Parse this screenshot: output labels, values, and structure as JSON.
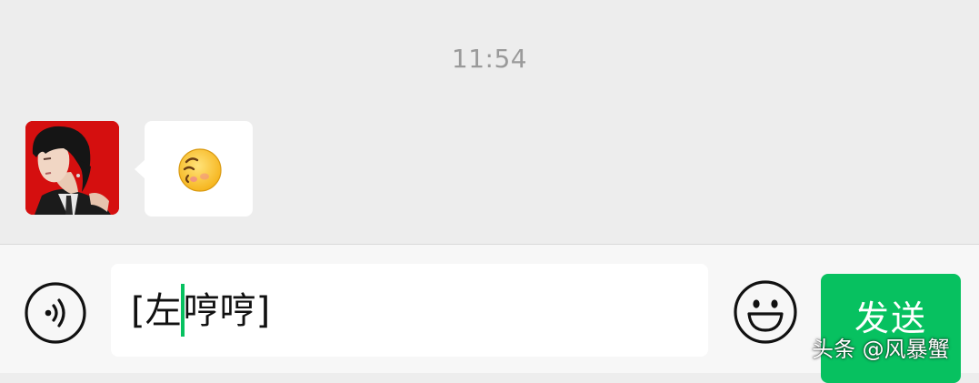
{
  "chat": {
    "timestamp": "11:54",
    "message": {
      "type": "emoji",
      "emoji_name": "hmph-face-emoji"
    }
  },
  "input_bar": {
    "text_before_caret": "[左",
    "text_after_caret": "哼哼]",
    "send_label": "发送",
    "voice_icon": "voice-icon",
    "emoji_icon": "emoji-smile-icon"
  },
  "watermark": "头条 @风暴蟹",
  "colors": {
    "background": "#ededed",
    "accent": "#07c160",
    "bubble": "#ffffff",
    "avatar_bg": "#d50f0f"
  }
}
